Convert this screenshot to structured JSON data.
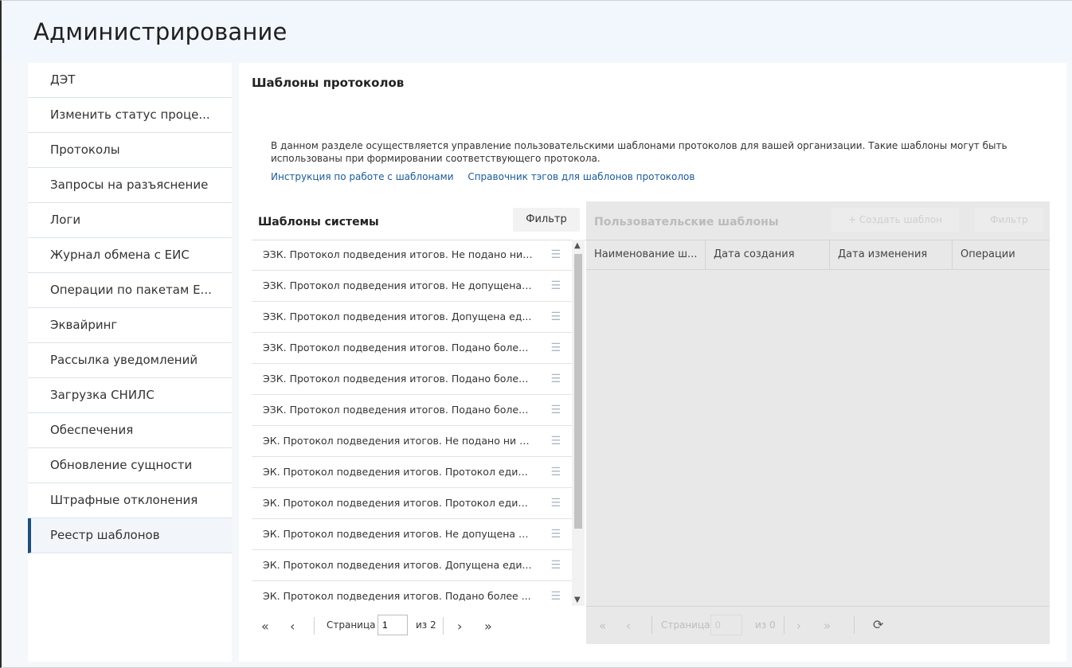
{
  "app": {
    "title": "Администрирование"
  },
  "sidebar": {
    "items": [
      {
        "label": "ДЭТ"
      },
      {
        "label": "Изменить статус проце..."
      },
      {
        "label": "Протоколы"
      },
      {
        "label": "Запросы на разъяснение"
      },
      {
        "label": "Логи"
      },
      {
        "label": "Журнал обмена с ЕИС"
      },
      {
        "label": "Операции по пакетам Е..."
      },
      {
        "label": "Эквайринг"
      },
      {
        "label": "Рассылка уведомлений"
      },
      {
        "label": "Загрузка СНИЛС"
      },
      {
        "label": "Обеспечения"
      },
      {
        "label": "Обновление сущности"
      },
      {
        "label": "Штрафные отклонения"
      },
      {
        "label": "Реестр шаблонов",
        "active": true
      }
    ]
  },
  "main": {
    "title": "Шаблоны протоколов",
    "description": "В данном разделе осуществляется управление пользовательскими шаблонами протоколов для вашей организации. Такие шаблоны могут быть использованы при формировании соответствующего протокола.",
    "links": {
      "instructions": "Инструкция по работе с шаблонами",
      "tags": "Справочник тэгов для шаблонов протоколов"
    },
    "system_templates": {
      "title": "Шаблоны системы",
      "filter_label": "Фильтр",
      "rows": [
        "ЭЗК. Протокол подведения итогов. Не подано ни ...",
        "ЭЗК. Протокол подведения итогов. Не допущена ...",
        "ЭЗК. Протокол подведения итогов. Допущена ед...",
        "ЭЗК. Протокол подведения итогов. Подано более...",
        "ЭЗК. Протокол подведения итогов. Подано более...",
        "ЭЗК. Протокол подведения итогов. Подано более...",
        "ЭК. Протокол подведения итогов. Не подано ни о...",
        "ЭК. Протокол подведения итогов. Протокол един...",
        "ЭК. Протокол подведения итогов. Протокол един...",
        "ЭК. Протокол подведения итогов. Не допущена е...",
        "ЭК. Протокол подведения итогов. Допущена еди...",
        "ЭК. Протокол подведения итогов. Подано более ..."
      ],
      "row_icon": "list-icon",
      "pager": {
        "first": "«",
        "prev": "‹",
        "page_label": "Страница",
        "page_value": "1",
        "of_label": "из 2",
        "next": "›",
        "last": "»"
      }
    },
    "user_templates": {
      "title": "Пользовательские шаблоны",
      "create_label": "+ Создать шаблон",
      "filter_label": "Фильтр",
      "columns": [
        "Наименование ш...",
        "Дата создания",
        "Дата изменения",
        "Операции"
      ],
      "pager": {
        "first": "«",
        "prev": "‹",
        "page_label": "Страница",
        "page_value": "0",
        "of_label": "из 0",
        "next": "›",
        "last": "»",
        "refresh_icon": "refresh-icon"
      }
    }
  }
}
